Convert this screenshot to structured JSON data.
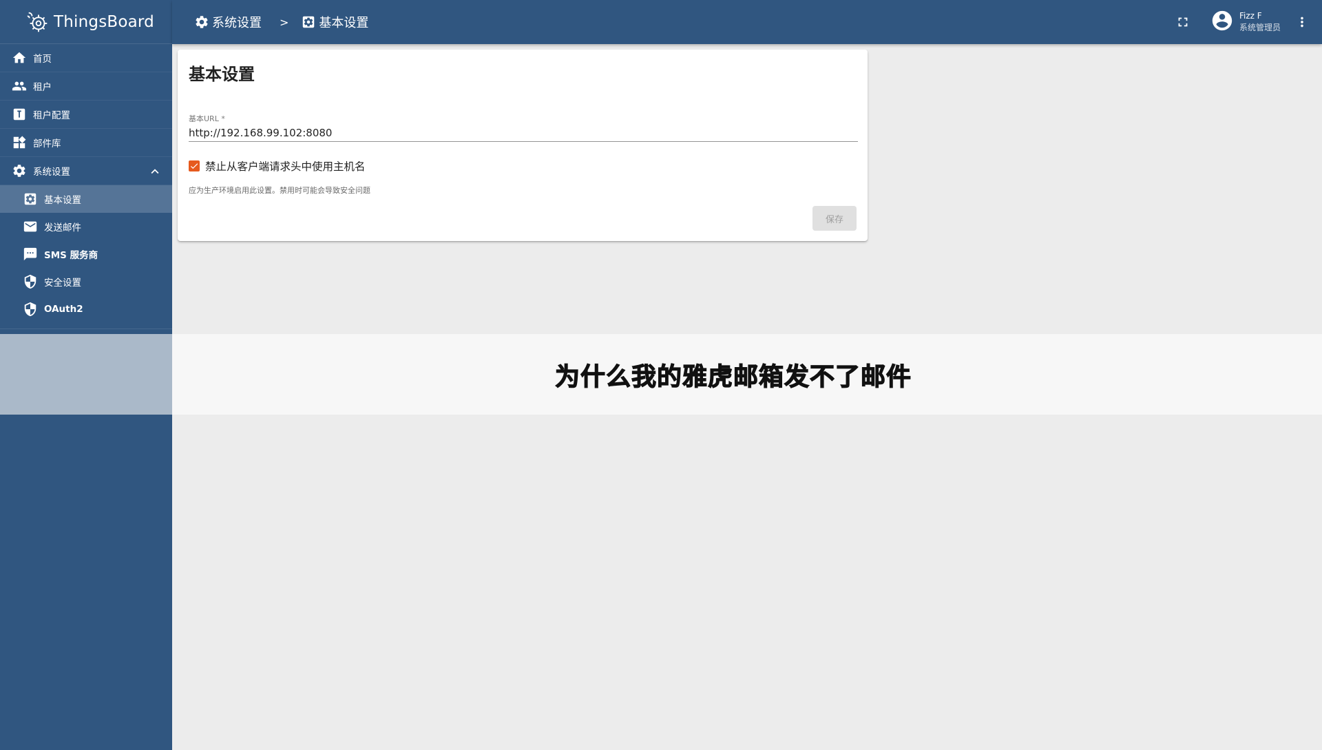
{
  "app": {
    "name": "ThingsBoard"
  },
  "sidebar": {
    "items": [
      {
        "label": "首页",
        "icon": "home-icon"
      },
      {
        "label": "租户",
        "icon": "people-icon"
      },
      {
        "label": "租户配置",
        "icon": "tenant-profile-icon"
      },
      {
        "label": "部件库",
        "icon": "widgets-icon"
      },
      {
        "label": "系统设置",
        "icon": "gear-icon",
        "expanded": true
      }
    ],
    "sub_items": [
      {
        "label": "基本设置",
        "icon": "settings-box-icon",
        "active": true
      },
      {
        "label": "发送邮件",
        "icon": "mail-icon"
      },
      {
        "label": "SMS 服务商",
        "icon": "sms-icon"
      },
      {
        "label": "安全设置",
        "icon": "security-icon"
      },
      {
        "label": "OAuth2",
        "icon": "security-icon"
      }
    ]
  },
  "header": {
    "breadcrumb": [
      {
        "label": "系统设置",
        "icon": "gear-icon"
      },
      {
        "label": "基本设置",
        "icon": "settings-box-icon"
      }
    ],
    "separator": ">",
    "user": {
      "name": "Fizz F",
      "role": "系统管理员"
    }
  },
  "card": {
    "title": "基本设置",
    "base_url_label": "基本URL *",
    "base_url_value": "http://192.168.99.102:8080",
    "checkbox_label": "禁止从客户端请求头中使用主机名",
    "checkbox_checked": true,
    "hint": "应为生产环境启用此设置。禁用时可能会导致安全问题",
    "save_label": "保存"
  },
  "overlay": {
    "caption": "为什么我的雅虎邮箱发不了邮件"
  },
  "colors": {
    "primary": "#305680",
    "accent": "#e65a1e",
    "background": "#ececec"
  }
}
